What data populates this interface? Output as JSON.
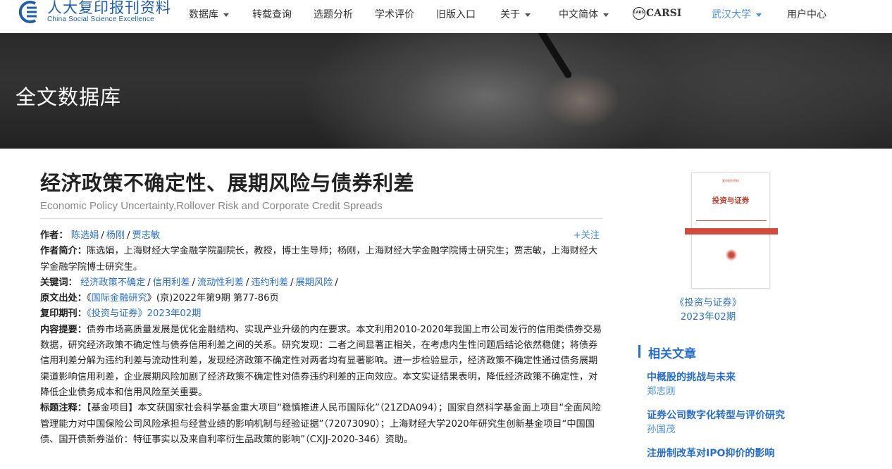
{
  "nav": {
    "logo_cn": "人大复印报刊资料",
    "logo_en": "China Social Science Excellence",
    "items": [
      {
        "label": "数据库",
        "caret": true
      },
      {
        "label": "转载查询",
        "caret": false
      },
      {
        "label": "选题分析",
        "caret": false
      },
      {
        "label": "学术评价",
        "caret": false
      },
      {
        "label": "旧版入口",
        "caret": false
      },
      {
        "label": "关于",
        "caret": true
      },
      {
        "label": "中文简体",
        "caret": true
      }
    ],
    "carsi_badge": "CARSI",
    "carsi": "CARSI",
    "institution": "武汉大学",
    "user_center": "用户中心"
  },
  "banner": {
    "title": "全文数据库"
  },
  "article": {
    "title": "经济政策不确定性、展期风险与债券利差",
    "subtitle": "Economic Policy Uncertainty,Rollover Risk and Corporate Credit Spreads",
    "follow": "+关注",
    "authors_label": "作者：",
    "authors": [
      "陈选娟",
      "杨刚",
      "贾志敏"
    ],
    "bio_label": "作者简介：",
    "bio": "陈选娟，上海财经大学金融学院副院长，教授，博士生导师；杨刚，上海财经大学金融学院博士研究生；贾志敏，上海财经大学金融学院博士研究生。",
    "keywords_label": "关键词：",
    "keywords": [
      "经济政策不确定",
      "信用利差",
      "流动性利差",
      "违约利差",
      "展期风险"
    ],
    "source_label": "原文出处：",
    "source_open": "《",
    "source_journal": "国际金融研究",
    "source_rest": "》(京)2022年第9期 第77-86页",
    "reprint_label": "复印期刊：",
    "reprint_journal": "《投资与证券》2023年02期",
    "abstract_label": "内容提要：",
    "abstract": "债券市场高质量发展是优化金融结构、实现产业升级的内在要求。本文利用2010-2020年我国上市公司发行的信用类债券交易数据，研究经济政策不确定性与债券信用利差之间的关系。研究发现：二者之间显著正相关，在考虑内生性问题后结论依然稳健；将债券信用利差分解为违约利差与流动性利差，发现经济政策不确定性对两者均有显著影响。进一步检验显示，经济政策不确定性通过债务展期渠道影响信用利差，企业展期风险加剧了经济政策不确定性对债券违约利差的正向效应。本文实证结果表明，降低经济政策不确定性，对降低企业债务成本和信用风险至关重要。",
    "notes_label": "标题注释：",
    "notes": "【基金项目】本文获国家社会科学基金重大项目“稳慎推进人民币国际化”（21ZDA094）；国家自然科学基金面上项目“全面风险管理能力对中国保险公司风险承担与经营业绩的影响机制与经验证据”（72073090）；上海财经大学2020年研究生创新基金项目“中国国债、国开债新券溢价：特征事实以及来自利率衍生品政策的影响”（CXJJ-2020-346）资助。"
  },
  "sidebar": {
    "cover_top": "复印报刊资料",
    "cover_title": "投资与证券",
    "journal_name": "《投资与证券》",
    "journal_issue": "2023年02期",
    "related_title": "相关文章",
    "related": [
      {
        "title": "中概股的挑战与未来",
        "author": "郑志刚"
      },
      {
        "title": "证券公司数字化转型与评价研究",
        "author": "孙国茂"
      },
      {
        "title": "注册制改革对IPO抑价的影响",
        "author": ""
      }
    ]
  }
}
